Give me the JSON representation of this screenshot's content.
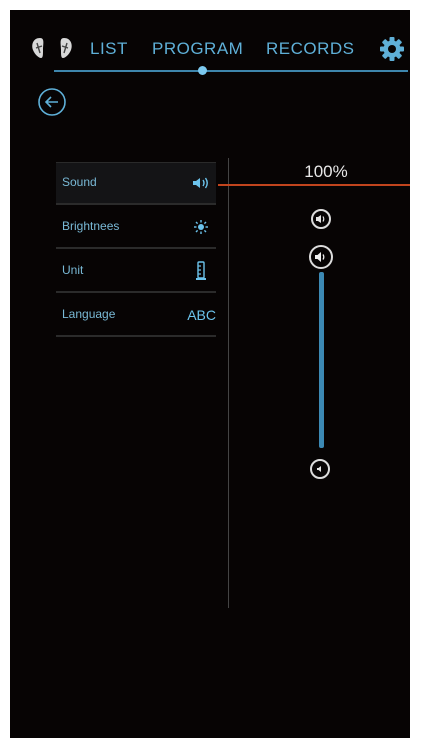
{
  "nav": {
    "items": [
      {
        "label": "LIST"
      },
      {
        "label": "PROGRAM"
      },
      {
        "label": "RECORDS"
      }
    ],
    "active_index": 1
  },
  "settings": {
    "items": [
      {
        "label": "Sound",
        "icon": "speaker-icon",
        "active": true
      },
      {
        "label": "Brightnees",
        "icon": "sun-icon",
        "active": false
      },
      {
        "label": "Unit",
        "icon": "ruler-icon",
        "active": false
      },
      {
        "label": "Language",
        "icon_text": "ABC",
        "active": false
      }
    ]
  },
  "sound": {
    "level_text": "100%",
    "level_fraction": 1.0
  },
  "colors": {
    "background": "#070404",
    "accent": "#5fb0d8",
    "pointer": "#c1441d"
  }
}
